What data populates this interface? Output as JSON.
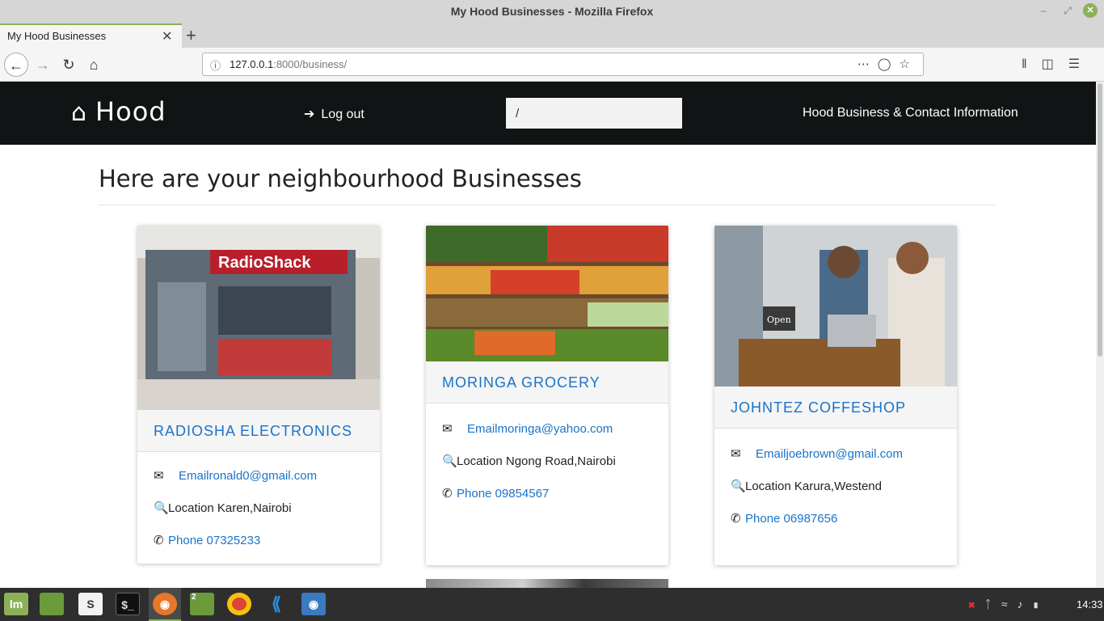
{
  "window": {
    "title": "My Hood Businesses - Mozilla Firefox",
    "minimize_glyph": "‒",
    "maximize_glyph": "⤢",
    "close_glyph": "✕"
  },
  "browser": {
    "tab_title": "My Hood Businesses",
    "tab_close": "✕",
    "new_tab": "+",
    "url_host": "127.0.0.1",
    "url_rest": ":8000/business/",
    "icons": [
      "info-icon",
      "more-icon",
      "pocket-icon",
      "bookmark-star-icon",
      "library-icon",
      "sidebar-icon",
      "menu-icon"
    ]
  },
  "site": {
    "brand": "Hood",
    "logout": "Log out",
    "search_value": "/",
    "contact_link": "Hood Business & Contact Information",
    "heading": "Here are your neighbourhood Businesses"
  },
  "businesses": [
    {
      "name": "RADIOSHA ELECTRONICS",
      "email": "Emailronald0@gmail.com",
      "location": "Location Karen,Nairobi",
      "phone": "Phone 07325233",
      "image_text": "RadioShack"
    },
    {
      "name": "MORINGA GROCERY",
      "email": "Emailmoringa@yahoo.com",
      "location": "Location Ngong Road,Nairobi",
      "phone": "Phone 09854567"
    },
    {
      "name": "JOHNTEZ COFFESHOP",
      "email": "Emailjoebrown@gmail.com",
      "location": "Location Karura,Westend",
      "phone": "Phone 06987656",
      "image_text": "Open"
    }
  ],
  "taskbar": {
    "apps": [
      "mint-menu-icon",
      "files-icon",
      "slack-icon",
      "terminal-icon",
      "firefox-icon",
      "files-icon",
      "chrome-icon",
      "vscode-icon",
      "screenshot-icon"
    ],
    "files_badge": "2",
    "clock": "14:33"
  },
  "colors": {
    "accent": "#8bb158",
    "link": "#1a73c8",
    "navbar": "#111414"
  }
}
